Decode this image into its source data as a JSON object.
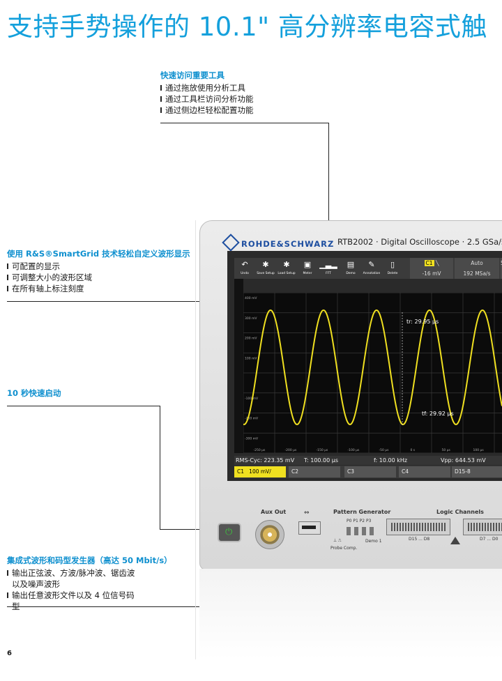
{
  "page_title": "支持手势操作的 10.1\" 高分辨率电容式触",
  "page_number": "6",
  "callouts": {
    "tools": {
      "title": "快速访问重要工具",
      "items": [
        "通过拖放使用分析工具",
        "通过工具栏访问分析功能",
        "通过侧边栏轻松配置功能"
      ]
    },
    "smartgrid": {
      "title": "使用 R&S®SmartGrid 技术轻松自定义波形显示",
      "items": [
        "可配置的显示",
        "可调整大小的波形区域",
        "在所有轴上标注刻度"
      ]
    },
    "startup": {
      "title": "10 秒快速启动"
    },
    "generator": {
      "title": "集成式波形和码型发生器（高达 50 Mbit/s）",
      "items": [
        "输出正弦波、方波/脉冲波、锯齿波以及噪声波形",
        "输出任意波形文件以及 4 位信号码型"
      ]
    }
  },
  "device": {
    "brand": "ROHDE&SCHWARZ",
    "model": "RTB2002 · Digital Oscilloscope · 2.5 GSa/s",
    "toolbar": [
      {
        "label": "Undo",
        "icon": "undo-icon"
      },
      {
        "label": "Save Setup",
        "icon": "gear-icon"
      },
      {
        "label": "Load Setup",
        "icon": "gear-icon"
      },
      {
        "label": "Meter",
        "icon": "meter-icon"
      },
      {
        "label": "FFT",
        "icon": "fft-icon"
      },
      {
        "label": "Demo",
        "icon": "demo-icon"
      },
      {
        "label": "Annotation",
        "icon": "pen-icon"
      },
      {
        "label": "Delete",
        "icon": "trash-icon"
      }
    ],
    "trigger": {
      "source": "C1",
      "level": "-16 mV",
      "mode": "Auto",
      "rate": "192 MSa/s",
      "extra": "50"
    },
    "y_ticks": [
      "400 mV",
      "300 mV",
      "200 mV",
      "100 mV",
      "",
      "-100 mV",
      "-200 mV",
      "-300 mV",
      "-400 mV"
    ],
    "x_ticks": [
      "-250 µs",
      "-200 µs",
      "-150 µs",
      "-100 µs",
      "-50 µs",
      "0 s",
      "50 µs",
      "100 µs",
      "150 µs"
    ],
    "cursor_rise": "tr: 29.95 µs",
    "cursor_fall": "tf: 29.92 µs",
    "measurements": {
      "rms": "RMS-Cyc: 223.35 mV",
      "t": "T: 100.00 µs",
      "f": "f: 10.00 kHz",
      "vpp": "Vpp: 644.53 mV"
    },
    "channels": {
      "c1": "C1",
      "c1_scale": "100 mV/",
      "c2": "C2",
      "c3": "C3",
      "c4": "C4",
      "d": "D15-8"
    },
    "panel": {
      "aux_out": "Aux Out",
      "pattern_generator": "Pattern Generator",
      "pins": "P0  P1  P2  P3",
      "probe_comp": "Probe Comp.",
      "demo1": "Demo 1",
      "logic_channels": "Logic Channels",
      "logic_left": "D15 ... D8",
      "logic_right": "D7 ... D0"
    },
    "colors": {
      "trace": "#f0e020",
      "accent": "#14a0dc",
      "bezel": "#2a2a2a"
    }
  }
}
